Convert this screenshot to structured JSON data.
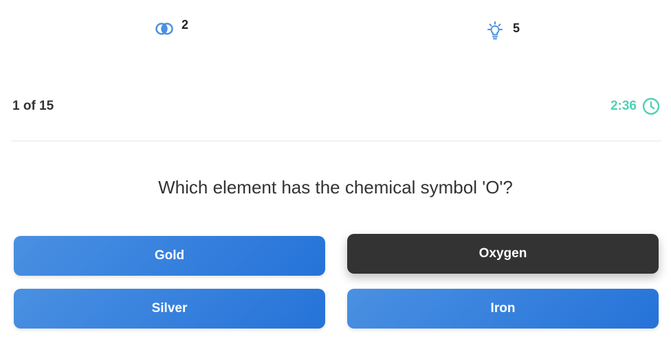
{
  "lifelines": {
    "fifty_fifty": {
      "icon": "fifty-fifty-icon",
      "count": "2"
    },
    "hints": {
      "icon": "lightbulb-icon",
      "count": "5"
    }
  },
  "progress": {
    "counter": "1 of 15",
    "timer": "2:36",
    "timer_icon": "clock-icon"
  },
  "question": {
    "text": "Which element has the chemical symbol 'O'?"
  },
  "answers": [
    {
      "label": "Gold",
      "selected": false
    },
    {
      "label": "Oxygen",
      "selected": true
    },
    {
      "label": "Silver",
      "selected": false
    },
    {
      "label": "Iron",
      "selected": false
    }
  ],
  "colors": {
    "accent": "#2573d9",
    "accent_light": "#4a90e2",
    "selected": "#333333",
    "timer": "#4fd1b3",
    "icon": "#4a90e2"
  }
}
